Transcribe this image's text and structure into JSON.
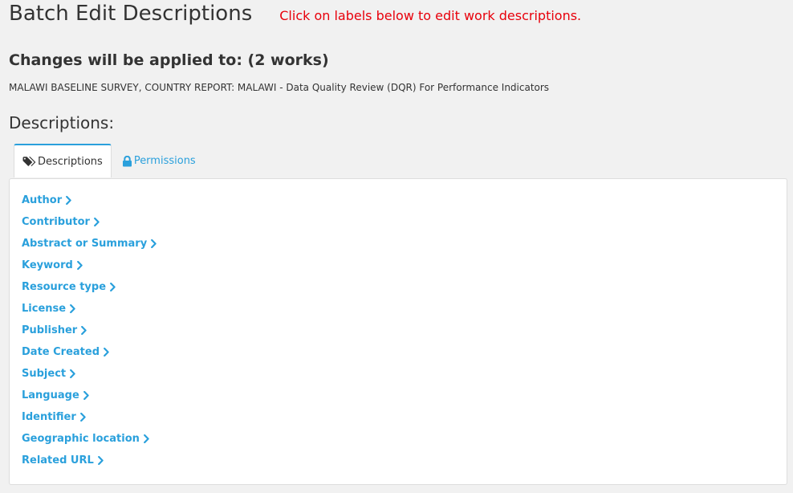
{
  "header": {
    "title": "Batch Edit Descriptions",
    "instruction": "Click on labels below to edit work descriptions."
  },
  "changes": {
    "heading": "Changes will be applied to: (2 works)",
    "works": "MALAWI BASELINE SURVEY, COUNTRY REPORT: MALAWI - Data Quality Review (DQR) For Performance Indicators"
  },
  "descriptions": {
    "heading": "Descriptions:"
  },
  "tabs": [
    {
      "label": "Descriptions",
      "icon": "tags-icon",
      "active": true
    },
    {
      "label": "Permissions",
      "icon": "lock-icon",
      "active": false
    }
  ],
  "fields": [
    {
      "label": "Author"
    },
    {
      "label": "Contributor"
    },
    {
      "label": "Abstract or Summary"
    },
    {
      "label": "Keyword"
    },
    {
      "label": "Resource type"
    },
    {
      "label": "License"
    },
    {
      "label": "Publisher"
    },
    {
      "label": "Date Created"
    },
    {
      "label": "Subject"
    },
    {
      "label": "Language"
    },
    {
      "label": "Identifier"
    },
    {
      "label": "Geographic location"
    },
    {
      "label": "Related URL"
    }
  ],
  "colors": {
    "link": "#2aa0dc",
    "instruction": "#e8000b",
    "text": "#333333",
    "background": "#f1f1f1"
  }
}
